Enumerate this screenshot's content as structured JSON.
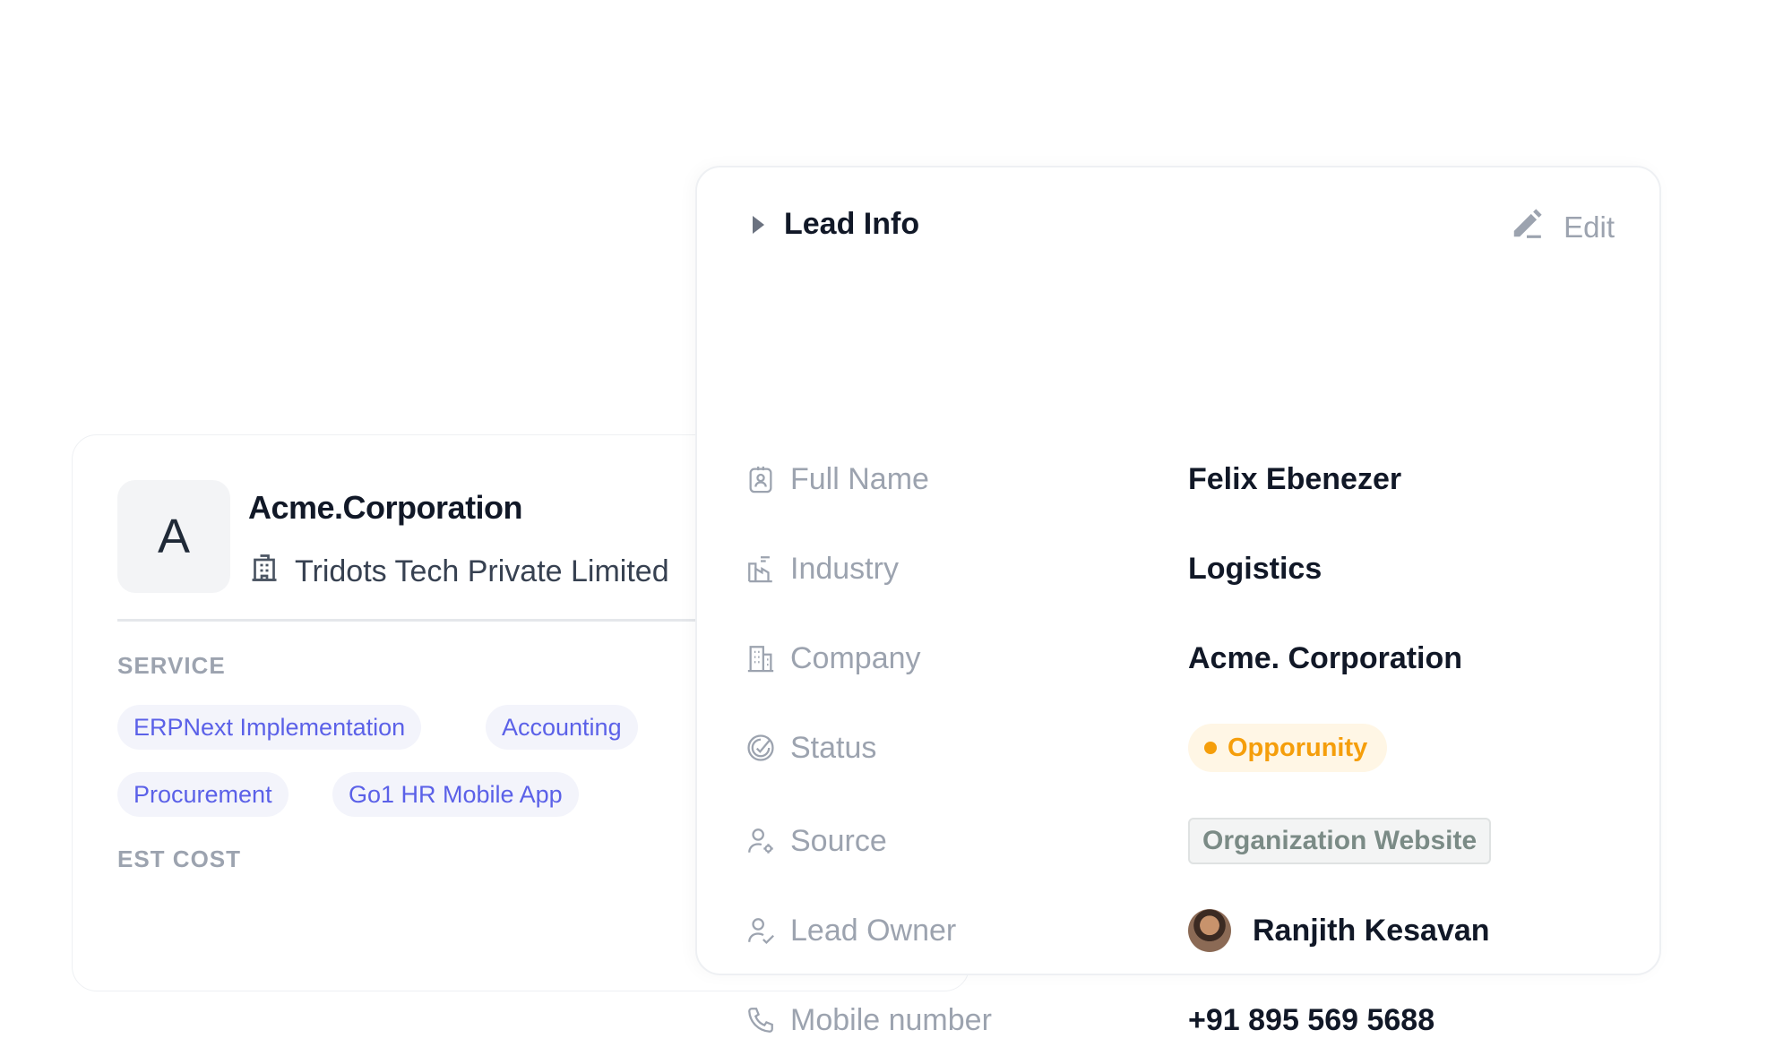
{
  "org_card": {
    "avatar_letter": "A",
    "name": "Acme.Corporation",
    "company": "Tridots Tech Private Limited",
    "service_label": "SERVICE",
    "services": [
      "ERPNext Implementation",
      "Accounting",
      "Procurement",
      "Go1 HR Mobile App"
    ],
    "est_cost_label": "EST COST"
  },
  "lead_card": {
    "title": "Lead Info",
    "edit_label": "Edit",
    "fields": {
      "full_name": {
        "label": "Full Name",
        "value": "Felix Ebenezer"
      },
      "industry": {
        "label": "Industry",
        "value": "Logistics"
      },
      "company": {
        "label": "Company",
        "value": "Acme. Corporation"
      },
      "status": {
        "label": "Status",
        "value": "Opporunity"
      },
      "source": {
        "label": "Source",
        "value": "Organization Website"
      },
      "lead_owner": {
        "label": "Lead Owner",
        "value": "Ranjith Kesavan"
      },
      "mobile": {
        "label": "Mobile number",
        "value": "+91 895 569 5688"
      }
    }
  },
  "colors": {
    "accent_tag_text": "#5b61e8",
    "accent_tag_bg": "#f3f4fb",
    "status_text": "#f59e0b",
    "status_bg": "#fff6e5",
    "muted_text": "#9ca3af"
  },
  "icons": [
    "caret-right-icon",
    "pencil-icon",
    "id-badge-icon",
    "factory-icon",
    "building-icon",
    "status-gauge-icon",
    "user-gear-icon",
    "user-check-icon",
    "phone-icon",
    "office-building-icon"
  ]
}
